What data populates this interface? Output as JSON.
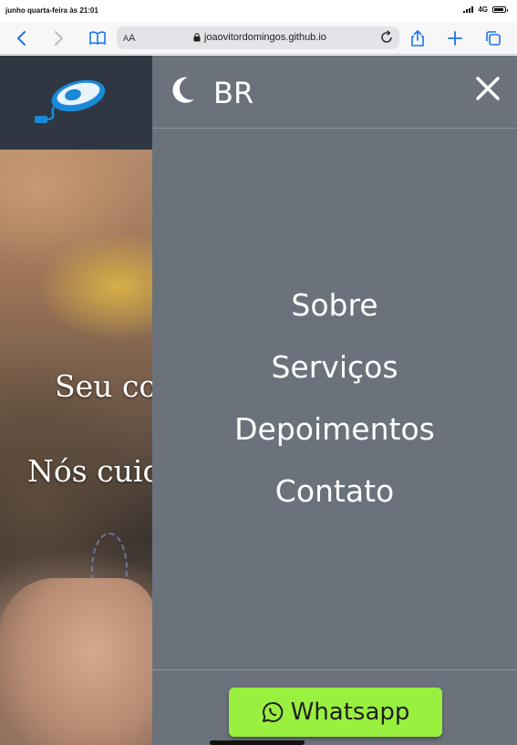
{
  "status_bar": {
    "time": "junho quarta-feira às 21:01",
    "network": "4G"
  },
  "browser": {
    "text_size_small": "A",
    "text_size_large": "A",
    "url": "joaovitordomingos.github.io",
    "icons": {
      "back": "chevron-left-icon",
      "forward": "chevron-right-icon",
      "bookmarks": "book-icon",
      "lock": "lock-icon",
      "reload": "reload-icon",
      "share": "share-icon",
      "new_tab": "plus-icon",
      "tabs": "tabs-icon"
    }
  },
  "site": {
    "logo": "computer-mouse-logo",
    "hero_line1": "Seu co",
    "hero_line2": "Nós cuid"
  },
  "menu": {
    "theme_icon": "moon-icon",
    "language": "BR",
    "close_icon": "close-icon",
    "items": [
      {
        "label": "Sobre"
      },
      {
        "label": "Serviços"
      },
      {
        "label": "Depoimentos"
      },
      {
        "label": "Contato"
      }
    ],
    "whatsapp_label": "Whatsapp",
    "whatsapp_icon": "whatsapp-icon"
  },
  "colors": {
    "header_bg": "#2f3743",
    "menu_bg": "#6b727c",
    "whatsapp_button": "#9af03f",
    "safari_blue": "#1a73e8"
  }
}
